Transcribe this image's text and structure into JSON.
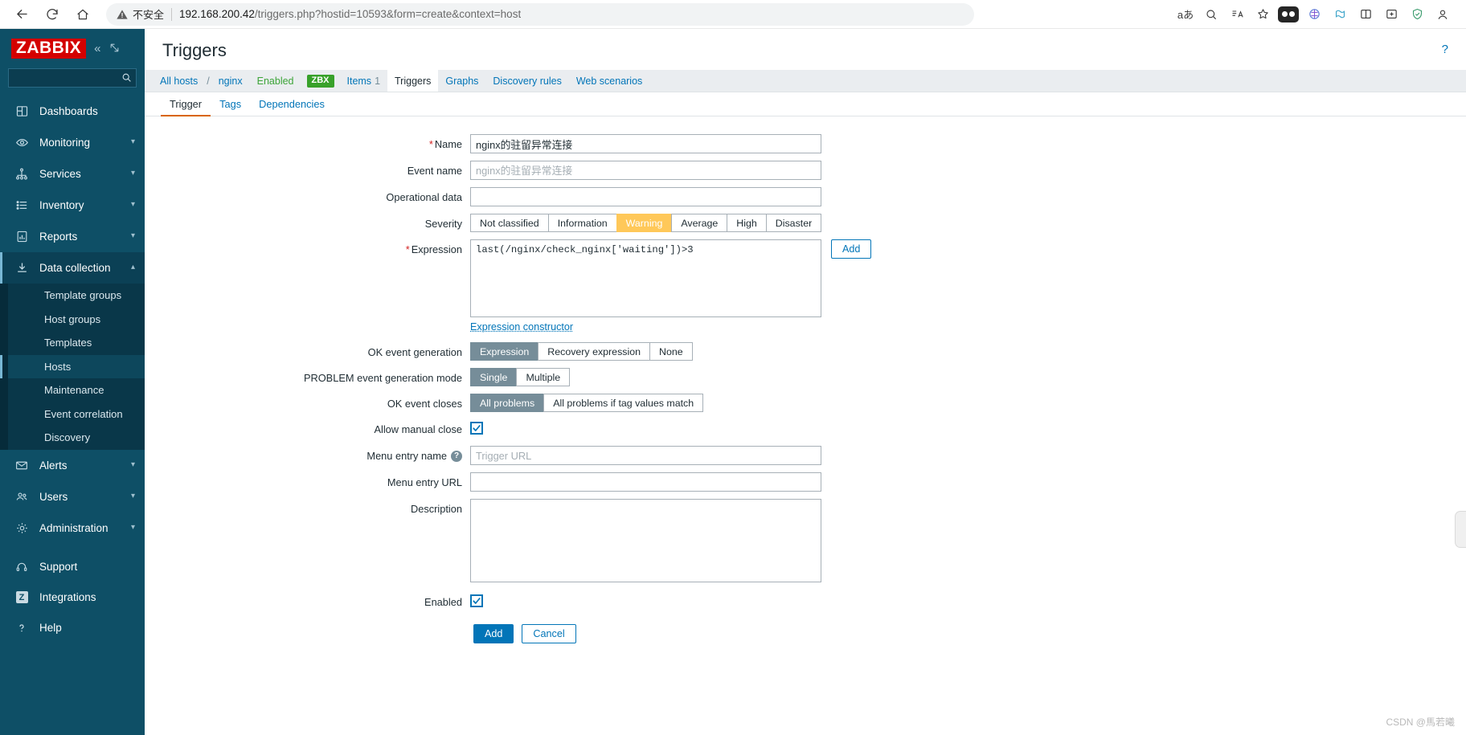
{
  "browser": {
    "back_icon": "arrow-left-icon",
    "reload_icon": "reload-icon",
    "home_icon": "home-icon",
    "security_label": "不安全",
    "url_host": "192.168.200.42",
    "url_path": "/triggers.php?hostid=10593&form=create&context=host",
    "toolbar_icons": [
      "read-aloud-icon",
      "zoom-icon",
      "immersive-reader-icon",
      "favorite-icon",
      "extension-icon",
      "browser-essentials-icon",
      "collections-icon",
      "split-screen-icon",
      "add-tab-icon",
      "shield-icon",
      "profile-icon"
    ]
  },
  "sidebar": {
    "logo": "ZABBIX",
    "collapse_icon": "chevron-double-left-icon",
    "hide_icon": "collapse-panel-icon",
    "search_placeholder": "",
    "search_value": "",
    "items": [
      {
        "label": "Dashboards",
        "icon": "dashboard-icon",
        "caret": false
      },
      {
        "label": "Monitoring",
        "icon": "eye-icon",
        "caret": true
      },
      {
        "label": "Services",
        "icon": "services-tree-icon",
        "caret": true
      },
      {
        "label": "Inventory",
        "icon": "list-icon",
        "caret": true
      },
      {
        "label": "Reports",
        "icon": "report-chart-icon",
        "caret": true
      },
      {
        "label": "Data collection",
        "icon": "download-icon",
        "caret": true,
        "expanded": true
      }
    ],
    "submenu": [
      {
        "label": "Template groups"
      },
      {
        "label": "Host groups"
      },
      {
        "label": "Templates"
      },
      {
        "label": "Hosts",
        "active": true
      },
      {
        "label": "Maintenance"
      },
      {
        "label": "Event correlation"
      },
      {
        "label": "Discovery"
      }
    ],
    "items_after": [
      {
        "label": "Alerts",
        "icon": "envelope-icon",
        "caret": true
      },
      {
        "label": "Users",
        "icon": "users-icon",
        "caret": true
      },
      {
        "label": "Administration",
        "icon": "gear-icon",
        "caret": true
      }
    ],
    "bottom_items": [
      {
        "label": "Support",
        "icon": "headset-icon"
      },
      {
        "label": "Integrations",
        "icon": "z-badge-icon"
      },
      {
        "label": "Help",
        "icon": "question-icon"
      }
    ]
  },
  "header": {
    "title": "Triggers",
    "help_icon": "question-mark-icon"
  },
  "breadcrumb": {
    "all_hosts": "All hosts",
    "separator": "/",
    "host": "nginx",
    "status": "Enabled",
    "agent_badge": "ZBX",
    "items_label": "Items",
    "items_count": "1",
    "triggers_label": "Triggers",
    "graphs_label": "Graphs",
    "discovery_label": "Discovery rules",
    "web_label": "Web scenarios"
  },
  "tabs": [
    {
      "label": "Trigger",
      "active": true
    },
    {
      "label": "Tags",
      "active": false
    },
    {
      "label": "Dependencies",
      "active": false
    }
  ],
  "form": {
    "name": {
      "label": "Name",
      "required": true,
      "value": "nginx的驻留异常连接",
      "placeholder": ""
    },
    "event_name": {
      "label": "Event name",
      "value": "",
      "placeholder": "nginx的驻留异常连接"
    },
    "operational_data": {
      "label": "Operational data",
      "value": "",
      "placeholder": ""
    },
    "severity": {
      "label": "Severity",
      "options": [
        "Not classified",
        "Information",
        "Warning",
        "Average",
        "High",
        "Disaster"
      ],
      "selected": "Warning",
      "selected_color": "#ffc859"
    },
    "expression": {
      "label": "Expression",
      "required": true,
      "value": "last(/nginx/check_nginx['waiting'])>3",
      "add_button": "Add",
      "constructor_link": "Expression constructor"
    },
    "ok_event_generation": {
      "label": "OK event generation",
      "options": [
        "Expression",
        "Recovery expression",
        "None"
      ],
      "selected": "Expression"
    },
    "problem_event_generation_mode": {
      "label": "PROBLEM event generation mode",
      "options": [
        "Single",
        "Multiple"
      ],
      "selected": "Single"
    },
    "ok_event_closes": {
      "label": "OK event closes",
      "options": [
        "All problems",
        "All problems if tag values match"
      ],
      "selected": "All problems"
    },
    "allow_manual_close": {
      "label": "Allow manual close",
      "checked": true
    },
    "menu_entry_name": {
      "label": "Menu entry name",
      "help_icon": "question-icon",
      "value": "",
      "placeholder": "Trigger URL"
    },
    "menu_entry_url": {
      "label": "Menu entry URL",
      "value": "",
      "placeholder": ""
    },
    "description": {
      "label": "Description",
      "value": "",
      "placeholder": ""
    },
    "enabled": {
      "label": "Enabled",
      "checked": true
    },
    "actions": {
      "submit": "Add",
      "cancel": "Cancel"
    }
  },
  "watermark": "CSDN @馬若曦",
  "colors": {
    "accent_blue": "#0275b8",
    "sidebar_bg": "#0e4f66",
    "severity_warning": "#ffc859",
    "selected_seg": "#768d99",
    "zbx_green": "#38a12a",
    "logo_red": "#d40000",
    "required_red": "#d31f1f",
    "tab_underline": "#d86500"
  }
}
